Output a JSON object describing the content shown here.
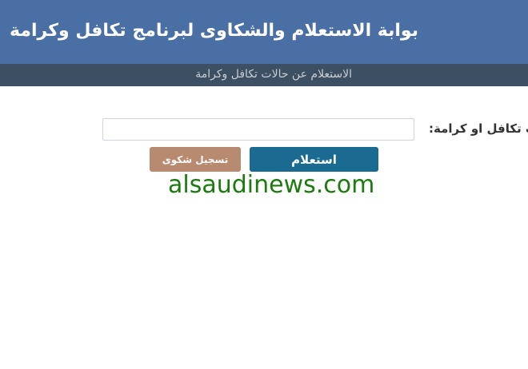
{
  "header": {
    "title": "بوابة الاستعلام والشكاوى لبرنامج تكافل وكرامة"
  },
  "subheader": {
    "title": "الاستعلام عن حالات تكافل وكرامة"
  },
  "form": {
    "label": "ت تكافل او كرامة:",
    "input_value": "",
    "input_placeholder": ""
  },
  "buttons": {
    "inquiry_label": "استعلام",
    "complaint_label": "تسجيل شكوى"
  },
  "watermark": {
    "text": "alsaudinews.com"
  },
  "colors": {
    "header_bg": "#4a6fa5",
    "subbar_bg": "#3d4f62",
    "inquiry_button": "#1a6a92",
    "complaint_button": "#b88a70",
    "watermark": "#1c7a0e"
  }
}
